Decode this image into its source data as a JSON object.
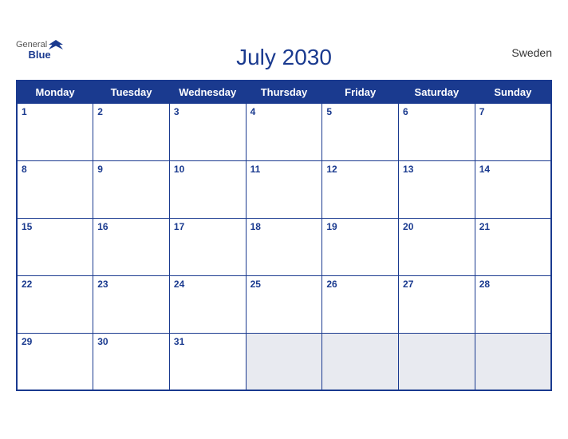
{
  "calendar": {
    "title": "July 2030",
    "country": "Sweden",
    "days_of_week": [
      "Monday",
      "Tuesday",
      "Wednesday",
      "Thursday",
      "Friday",
      "Saturday",
      "Sunday"
    ],
    "weeks": [
      [
        {
          "day": 1,
          "other": false
        },
        {
          "day": 2,
          "other": false
        },
        {
          "day": 3,
          "other": false
        },
        {
          "day": 4,
          "other": false
        },
        {
          "day": 5,
          "other": false
        },
        {
          "day": 6,
          "other": false
        },
        {
          "day": 7,
          "other": false
        }
      ],
      [
        {
          "day": 8,
          "other": false
        },
        {
          "day": 9,
          "other": false
        },
        {
          "day": 10,
          "other": false
        },
        {
          "day": 11,
          "other": false
        },
        {
          "day": 12,
          "other": false
        },
        {
          "day": 13,
          "other": false
        },
        {
          "day": 14,
          "other": false
        }
      ],
      [
        {
          "day": 15,
          "other": false
        },
        {
          "day": 16,
          "other": false
        },
        {
          "day": 17,
          "other": false
        },
        {
          "day": 18,
          "other": false
        },
        {
          "day": 19,
          "other": false
        },
        {
          "day": 20,
          "other": false
        },
        {
          "day": 21,
          "other": false
        }
      ],
      [
        {
          "day": 22,
          "other": false
        },
        {
          "day": 23,
          "other": false
        },
        {
          "day": 24,
          "other": false
        },
        {
          "day": 25,
          "other": false
        },
        {
          "day": 26,
          "other": false
        },
        {
          "day": 27,
          "other": false
        },
        {
          "day": 28,
          "other": false
        }
      ],
      [
        {
          "day": 29,
          "other": false
        },
        {
          "day": 30,
          "other": false
        },
        {
          "day": 31,
          "other": false
        },
        {
          "day": "",
          "other": true
        },
        {
          "day": "",
          "other": true
        },
        {
          "day": "",
          "other": true
        },
        {
          "day": "",
          "other": true
        }
      ]
    ],
    "logo": {
      "general": "General",
      "blue": "Blue"
    }
  }
}
